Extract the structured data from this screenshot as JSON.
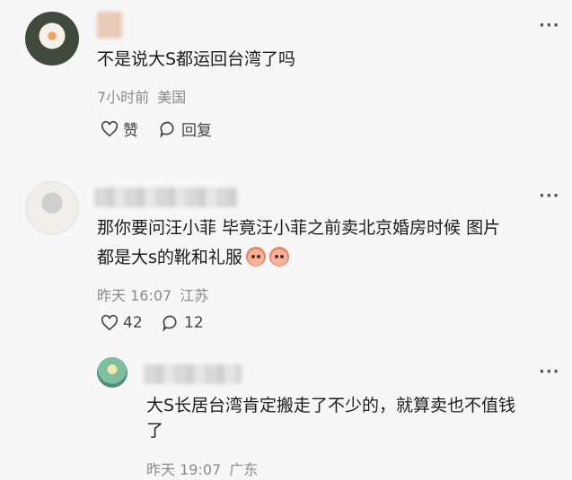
{
  "comments": [
    {
      "text": "不是说大S都运回台湾了吗",
      "time": "7小时前",
      "location": "美国",
      "like_label": "赞",
      "reply_label": "回复"
    },
    {
      "text_line1": "那你要问汪小菲 毕竟汪小菲之前卖北京婚房时候 图片",
      "text_line2": "都是大s的靴和礼服",
      "time": "昨天 16:07",
      "location": "江苏",
      "like_count": "42",
      "reply_count": "12"
    }
  ],
  "reply": {
    "text_line1": "大S长居台湾肯定搬走了不少的，就算卖也不值钱",
    "text_line2": "了",
    "time": "昨天 19:07",
    "location": "广东"
  },
  "icons": {
    "more": "more-dots-icon",
    "like": "heart-outline-icon",
    "reply": "speech-bubble-icon",
    "emoji": "crying-face-emoji"
  },
  "more_label": "···"
}
